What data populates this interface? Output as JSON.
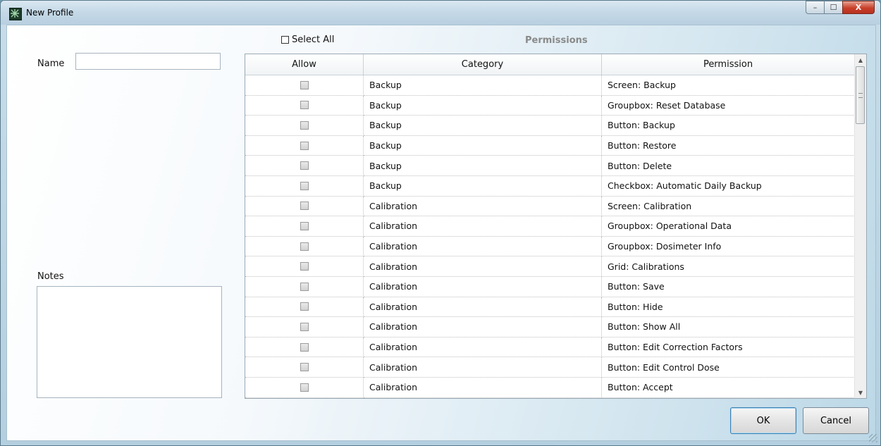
{
  "window": {
    "title": "New Profile",
    "controls": {
      "minimize": "–",
      "maximize": "☐",
      "close": "X"
    }
  },
  "form": {
    "name_label": "Name",
    "name_value": "",
    "notes_label": "Notes",
    "notes_value": ""
  },
  "permissions": {
    "select_all_label": "Select All",
    "title": "Permissions",
    "columns": {
      "allow": "Allow",
      "category": "Category",
      "permission": "Permission"
    },
    "rows": [
      {
        "category": "Backup",
        "permission": "Screen: Backup"
      },
      {
        "category": "Backup",
        "permission": "Groupbox: Reset Database"
      },
      {
        "category": "Backup",
        "permission": "Button: Backup"
      },
      {
        "category": "Backup",
        "permission": "Button: Restore"
      },
      {
        "category": "Backup",
        "permission": "Button: Delete"
      },
      {
        "category": "Backup",
        "permission": "Checkbox: Automatic Daily Backup"
      },
      {
        "category": "Calibration",
        "permission": "Screen: Calibration"
      },
      {
        "category": "Calibration",
        "permission": "Groupbox: Operational Data"
      },
      {
        "category": "Calibration",
        "permission": "Groupbox: Dosimeter Info"
      },
      {
        "category": "Calibration",
        "permission": "Grid: Calibrations"
      },
      {
        "category": "Calibration",
        "permission": "Button: Save"
      },
      {
        "category": "Calibration",
        "permission": "Button: Hide"
      },
      {
        "category": "Calibration",
        "permission": "Button: Show All"
      },
      {
        "category": "Calibration",
        "permission": "Button: Edit Correction Factors"
      },
      {
        "category": "Calibration",
        "permission": "Button: Edit Control Dose"
      },
      {
        "category": "Calibration",
        "permission": "Button: Accept"
      }
    ]
  },
  "buttons": {
    "ok": "OK",
    "cancel": "Cancel"
  }
}
